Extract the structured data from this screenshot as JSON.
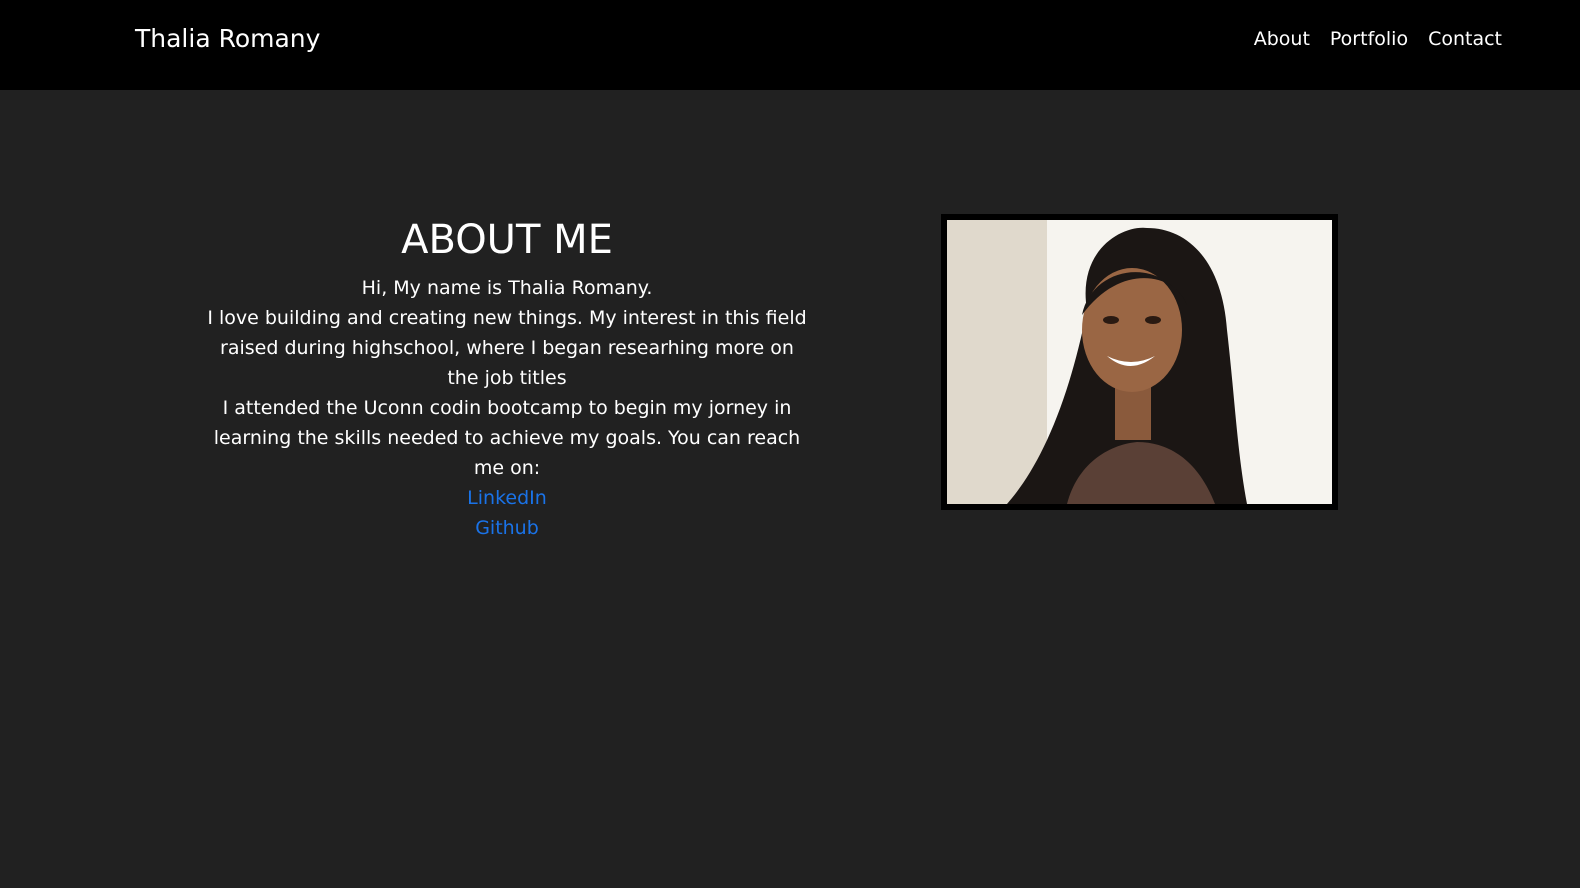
{
  "navbar": {
    "brand": "Thalia Romany",
    "links": [
      {
        "label": "About"
      },
      {
        "label": "Portfolio"
      },
      {
        "label": "Contact"
      }
    ]
  },
  "about": {
    "title": "ABOUT ME",
    "paragraphs": [
      "Hi, My name is Thalia Romany.",
      "I love building and creating new things. My interest in this field raised during highschool, where I began researhing more on the job titles",
      "I attended the Uconn codin bootcamp to begin my jorney in learning the skills needed to achieve my goals. You can reach me on:"
    ],
    "links": [
      {
        "label": "LinkedIn"
      },
      {
        "label": "Github"
      }
    ]
  },
  "colors": {
    "navbar_bg": "#000000",
    "page_bg": "#212121",
    "link": "#1a73e8"
  }
}
